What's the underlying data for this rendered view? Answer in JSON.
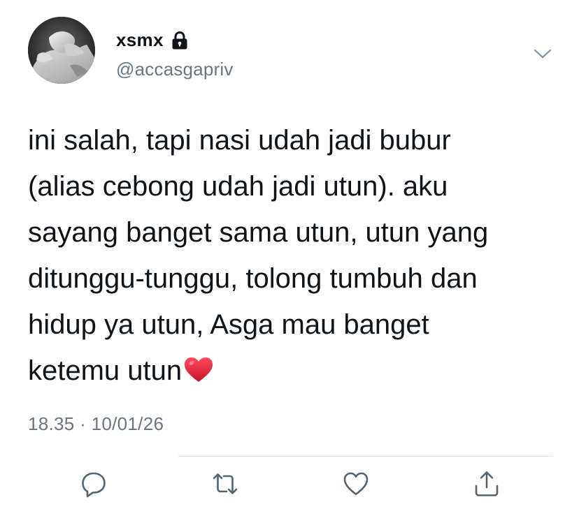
{
  "author": {
    "display_name": "xsmx",
    "handle": "@accasgapriv",
    "protected_icon": "lock-icon",
    "avatar_icon": "avatar"
  },
  "menu": {
    "icon": "chevron-down-icon"
  },
  "tweet": {
    "lines": [
      "ini salah, tapi nasi udah jadi bubur",
      "(alias cebong udah jadi utun). aku",
      "sayang banget sama utun, utun yang",
      "ditunggu-tunggu, tolong tumbuh dan",
      "hidup ya utun, Asga mau banget",
      "ketemu utun"
    ],
    "trailing_emoji": "red-heart-emoji"
  },
  "meta": {
    "time": "18.35",
    "separator": "·",
    "date": "10/01/26"
  },
  "actions": [
    {
      "icon": "reply-icon"
    },
    {
      "icon": "retweet-icon"
    },
    {
      "icon": "like-icon"
    },
    {
      "icon": "share-icon"
    }
  ],
  "colors": {
    "text": "#0f1419",
    "secondary": "#687684",
    "icon": "#536471",
    "divider": "#dfe3e7",
    "heart": "#e0243a"
  }
}
